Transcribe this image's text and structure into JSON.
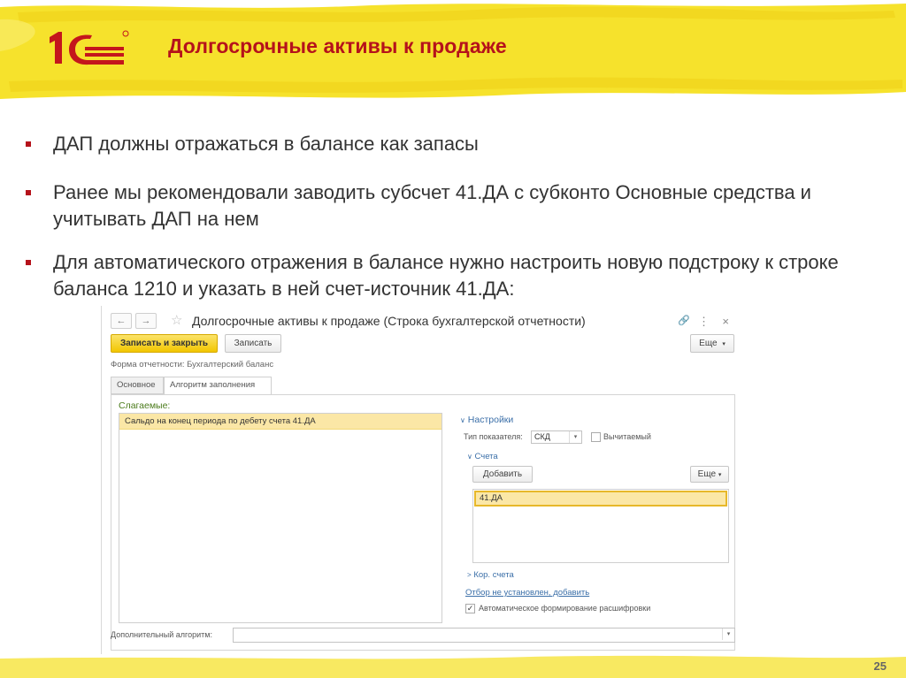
{
  "slide": {
    "title": "Долгосрочные активы к продаже",
    "page_number": "25",
    "logo_text": "1С",
    "bullets": [
      "ДАП должны отражаться в балансе как запасы",
      "Ранее мы рекомендовали заводить субсчет 41.ДА с субконто Основные средства и учитывать ДАП на нем",
      "Для автоматического отражения в балансе нужно настроить новую подстроку к строке баланса 1210 и указать в ней счет-источник 41.ДА:"
    ],
    "colors": {
      "accent": "#b5121b",
      "highlight": "#f7e233",
      "button": "#f2c600"
    }
  },
  "window": {
    "back_glyph": "←",
    "forward_glyph": "→",
    "star_glyph": "☆",
    "title": "Долгосрочные активы к продаже (Строка бухгалтерской отчетности)",
    "link_glyph": "🔗",
    "menu_glyph": "⋮",
    "close_glyph": "×",
    "toolbar": {
      "save_close": "Записать и закрыть",
      "save": "Записать",
      "more": "Еще"
    },
    "form_label": "Форма отчетности:",
    "form_value": "Бухгалтерский баланс",
    "tabs": [
      "Основное",
      "Алгоритм заполнения"
    ],
    "addends": {
      "label": "Слагаемые:",
      "rows": [
        "Сальдо на конец периода по дебету счета 41.ДА"
      ]
    },
    "settings": {
      "title": "Настройки",
      "indicator_type_label": "Тип показателя:",
      "indicator_type_value": "СКД",
      "subtractable_label": "Вычитаемый",
      "accounts_title": "Счета",
      "add_button": "Добавить",
      "more_button": "Еще",
      "accounts": [
        "41.ДА"
      ],
      "corr_accounts": "Кор. счета",
      "filter_link": "Отбор не установлен, добавить",
      "auto_breakdown_label": "Автоматическое формирование расшифровки",
      "auto_breakdown_checked": true
    },
    "extra_algorithm_label": "Дополнительный алгоритм:",
    "extra_algorithm_value": ""
  }
}
